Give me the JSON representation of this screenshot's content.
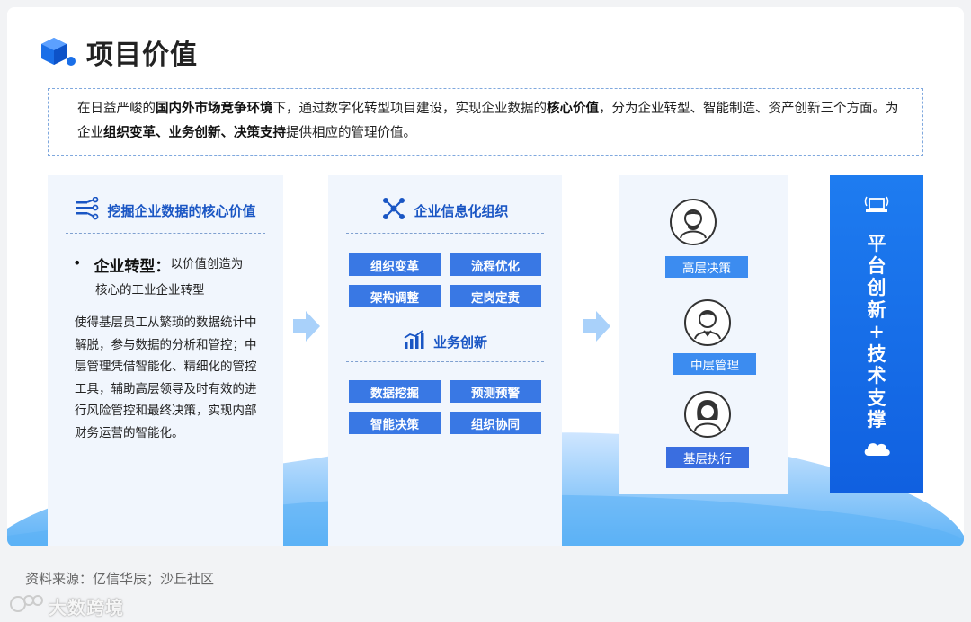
{
  "header": {
    "title": "项目价值"
  },
  "intro": {
    "t1": "在日益严峻的",
    "b1": "国内外市场竞争环境",
    "t2": "下，通过数字化转型项目建设，实现企业数据的",
    "b2": "核心价值",
    "t3": "，分为企业转型、智能制造、资产创新三个方面。为企业",
    "b3": "组织变革、业务创新、决策支持",
    "t4": "提供相应的管理价值。"
  },
  "panel1": {
    "heading": "挖掘企业数据的核心价值",
    "bullet": "•",
    "bullet_title": "企业转型：",
    "bullet_sub": "以价值创造为",
    "bullet_line2": "核心的工业企业转型",
    "body": "使得基层员工从繁琐的数据统计中解脱，参与数据的分析和管控；中层管理凭借智能化、精细化的管控工具，辅助高层领导及时有效的进行风险管控和最终决策，实现内部财务运营的智能化。"
  },
  "panel2": {
    "heading1": "企业信息化组织",
    "tags1": [
      "组织变革",
      "流程优化",
      "架构调整",
      "定岗定责"
    ],
    "heading2": "业务创新",
    "tags2": [
      "数据挖掘",
      "预测预警",
      "智能决策",
      "组织协同"
    ]
  },
  "panel3": {
    "roles": [
      "高层决策",
      "中层管理",
      "基层执行"
    ]
  },
  "panel4": {
    "chars": [
      "平",
      "台",
      "创",
      "新",
      "+",
      "技",
      "术",
      "支",
      "撑"
    ]
  },
  "footer": {
    "source": "资料来源：亿信华辰；沙丘社区",
    "watermark": "大数跨境"
  },
  "colors": {
    "accent": "#1a56c4",
    "tag": "#3978e4",
    "role": "#3c8cf0",
    "platform": "#1060e0",
    "panel_bg": "#f1f6fd"
  }
}
